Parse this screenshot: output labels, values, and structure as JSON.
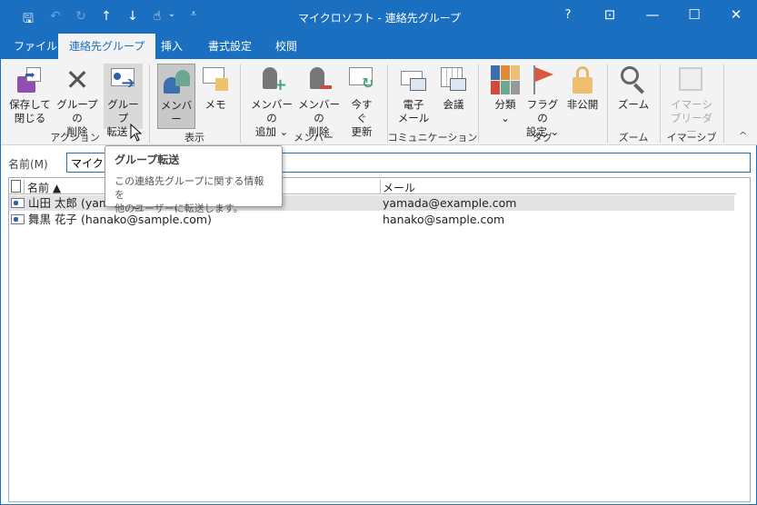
{
  "window": {
    "title": "マイクロソフト  -  連絡先グループ",
    "help": "?",
    "restore_ribbon": "⊡",
    "minimize": "—",
    "maximize": "☐",
    "close": "✕"
  },
  "qat": {
    "save": "🖫",
    "undo": "↶",
    "redo": "↻",
    "up": "↑",
    "down": "↓",
    "touch": "☝",
    "more": "⌄",
    "customize": "⩡"
  },
  "tabs": [
    "ファイル",
    "連絡先グループ",
    "挿入",
    "書式設定",
    "校閲"
  ],
  "ribbon": {
    "groups": [
      "アクション",
      "表示",
      "メンバー",
      "コミュニケーション",
      "タグ",
      "ズーム",
      "イマーシブ"
    ],
    "buttons": {
      "save_close": [
        "保存して",
        "閉じる"
      ],
      "delete_group": [
        "グループの",
        "削除"
      ],
      "forward_group": [
        "グループ",
        "転送 ⌄"
      ],
      "members": [
        "メンバー"
      ],
      "notes": [
        "メモ"
      ],
      "add_members": [
        "メンバーの",
        "追加 ⌄"
      ],
      "remove_member": [
        "メンバーの",
        "削除"
      ],
      "update_now": [
        "今すぐ",
        "更新"
      ],
      "email": [
        "電子",
        "メール"
      ],
      "meeting": [
        "会議"
      ],
      "categorize": [
        "分類",
        "⌄"
      ],
      "follow_up": [
        "フラグの",
        "設定 ⌄"
      ],
      "private": [
        "非公開"
      ],
      "zoom": [
        "ズーム"
      ],
      "immersive_reader": [
        "イマーシ",
        "ブリーダー"
      ]
    },
    "collapse": "^"
  },
  "name_field": {
    "label": "名前(M)",
    "value": "マイクロソフト"
  },
  "list": {
    "headers": {
      "name": "名前 ▲",
      "email": "メール"
    },
    "rows": [
      {
        "name": "山田 太郎 (yamada@example.com)",
        "email": "yamada@example.com"
      },
      {
        "name": "舞黒 花子 (hanako@sample.com)",
        "email": "hanako@sample.com"
      }
    ]
  },
  "tooltip": {
    "title": "グループ転送",
    "body_line1": "この連絡先グループに関する情報を",
    "body_line2": "他のユーザーに転送します。"
  }
}
